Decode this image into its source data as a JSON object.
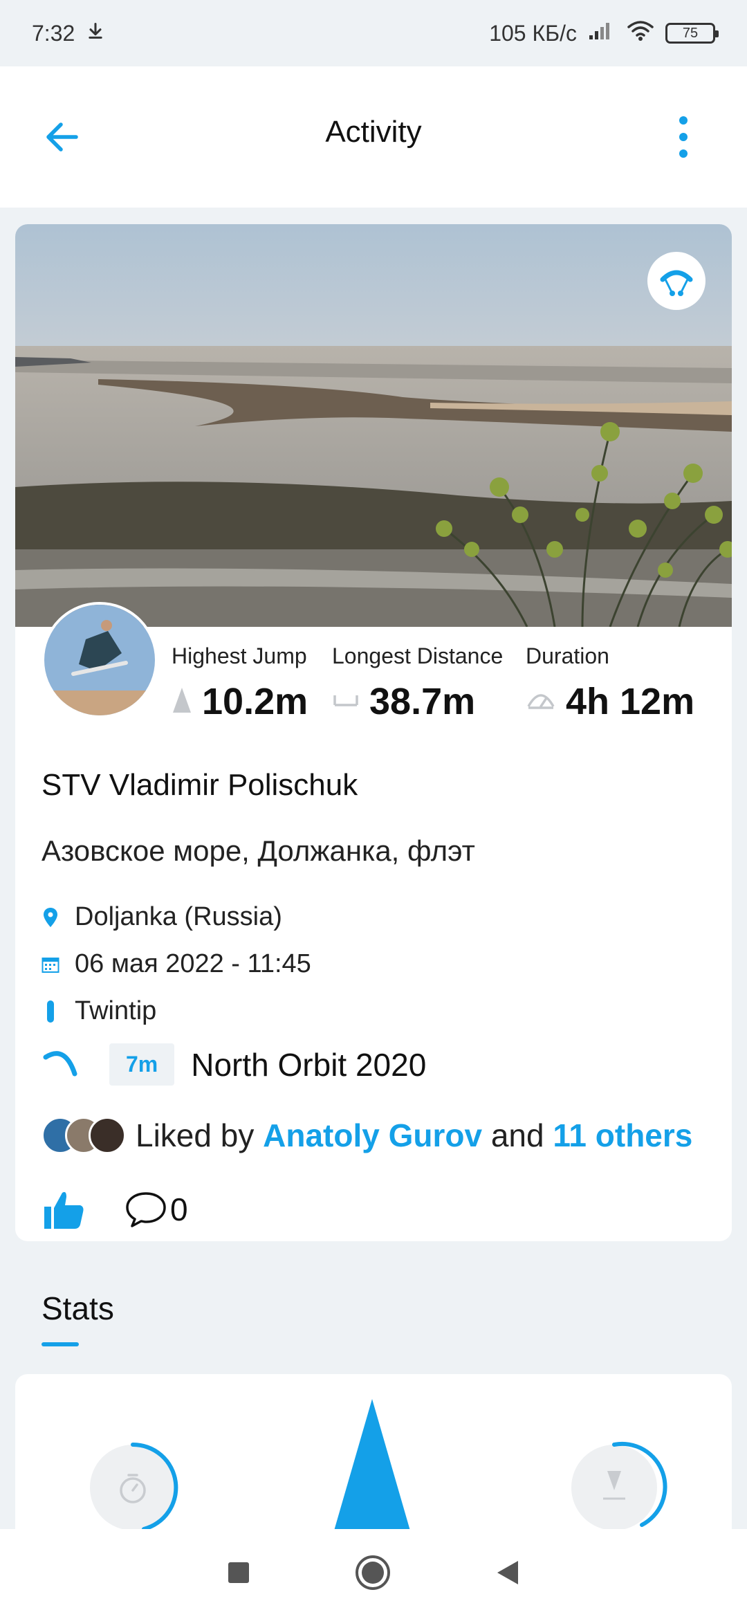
{
  "status_bar": {
    "time": "7:32",
    "network_speed": "105 КБ/с",
    "battery": "75"
  },
  "app_bar": {
    "title": "Activity",
    "back_icon": "arrow-left-icon",
    "menu_icon": "more-vertical-icon"
  },
  "activity": {
    "badge_icon": "kite-icon",
    "stats": [
      {
        "label": "Highest Jump",
        "value": "10.2m",
        "icon": "jump-icon"
      },
      {
        "label": "Longest Distance",
        "value": "38.7m",
        "icon": "distance-icon"
      },
      {
        "label": "Duration",
        "value": "4h 12m",
        "icon": "duration-icon"
      }
    ],
    "rider_name": "STV Vladimir Polischuk",
    "session_title": "Азовское море, Должанка, флэт",
    "location": "Doljanka (Russia)",
    "datetime": "06 мая 2022 - 11:45",
    "board": "Twintip",
    "kite": {
      "size": "7m",
      "name": "North Orbit 2020"
    },
    "likes": {
      "prefix": "Liked by",
      "first_liker": "Anatoly Gurov",
      "conjunction": "and",
      "others": "11 others"
    },
    "comment_count": "0"
  },
  "stats_section": {
    "tab_label": "Stats"
  },
  "colors": {
    "accent": "#14a0e8",
    "background": "#eef2f5"
  }
}
